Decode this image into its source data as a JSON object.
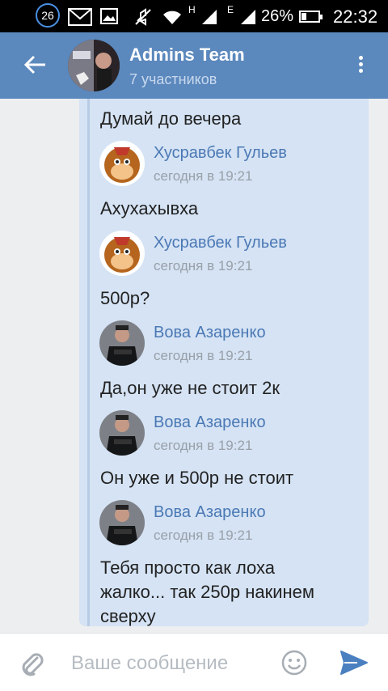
{
  "status_bar": {
    "notification_count": "26",
    "net_h": "H",
    "net_e": "E",
    "battery_percent": "26%",
    "battery_level": 0.26,
    "time": "22:32"
  },
  "header": {
    "title": "Admins Team",
    "subtitle": "7 участников"
  },
  "messages": [
    {
      "text": "Думай до вечера"
    },
    {
      "author": "Хусравбек Гульев",
      "time": "сегодня в 19:21",
      "text": "Ахухахывха",
      "avatar": "cartoon-monkey"
    },
    {
      "author": "Хусравбек Гульев",
      "time": "сегодня в 19:21",
      "text": "500р?",
      "avatar": "cartoon-monkey"
    },
    {
      "author": "Вова Азаренко",
      "time": "сегодня в 19:21",
      "text": "Да,он уже не стоит 2к",
      "avatar": "police-officer"
    },
    {
      "author": "Вова Азаренко",
      "time": "сегодня в 19:21",
      "text": "Он уже и 500р не стоит",
      "avatar": "police-officer"
    },
    {
      "author": "Вова Азаренко",
      "time": "сегодня в 19:21",
      "text_line1": "Тебя просто как лоха",
      "text_line2": "жалко... так 250р накинем",
      "text_line3": "сверху",
      "avatar": "police-officer"
    }
  ],
  "composer": {
    "placeholder": "Ваше сообщение"
  },
  "colors": {
    "header_bg": "#5b88bd",
    "bubble_bg": "#d5e3f4",
    "name_color": "#4b79b5",
    "send_color": "#4a7fc0"
  }
}
